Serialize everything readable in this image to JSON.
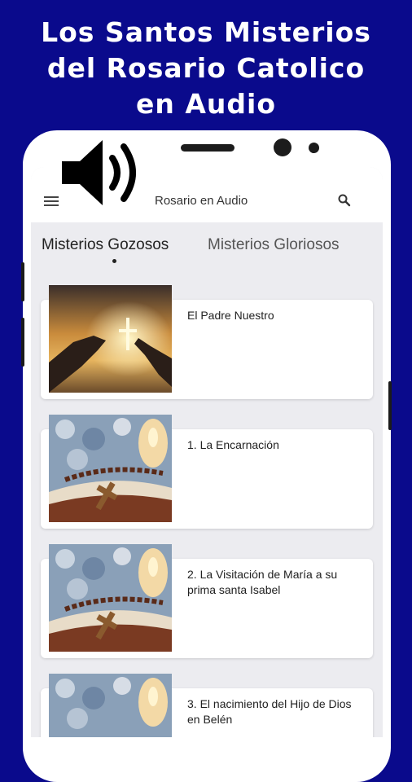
{
  "promo": {
    "line1": "Los Santos Misterios",
    "line2": "del Rosario Catolico",
    "line3": "en Audio"
  },
  "appbar": {
    "title": "Rosario en Audio",
    "menu_icon": "hamburger-menu-icon",
    "search_icon": "search-icon"
  },
  "tabs": [
    {
      "label": "Misterios Gozosos",
      "active": true
    },
    {
      "label": "Misterios Gloriosos",
      "active": false
    }
  ],
  "items": [
    {
      "title": "El Padre Nuestro",
      "image": "hands-cross-sunset"
    },
    {
      "title": "1. La Encarnación",
      "image": "rosary-bible-candle"
    },
    {
      "title": "2. La Visitación de María a su prima santa Isabel",
      "image": "rosary-bible-candle"
    },
    {
      "title": "3. El nacimiento del Hijo de Dios en Belén",
      "image": "rosary-bible-candle"
    }
  ],
  "colors": {
    "background": "#0a0a8c",
    "screen": "#ececf0",
    "card": "#ffffff"
  }
}
